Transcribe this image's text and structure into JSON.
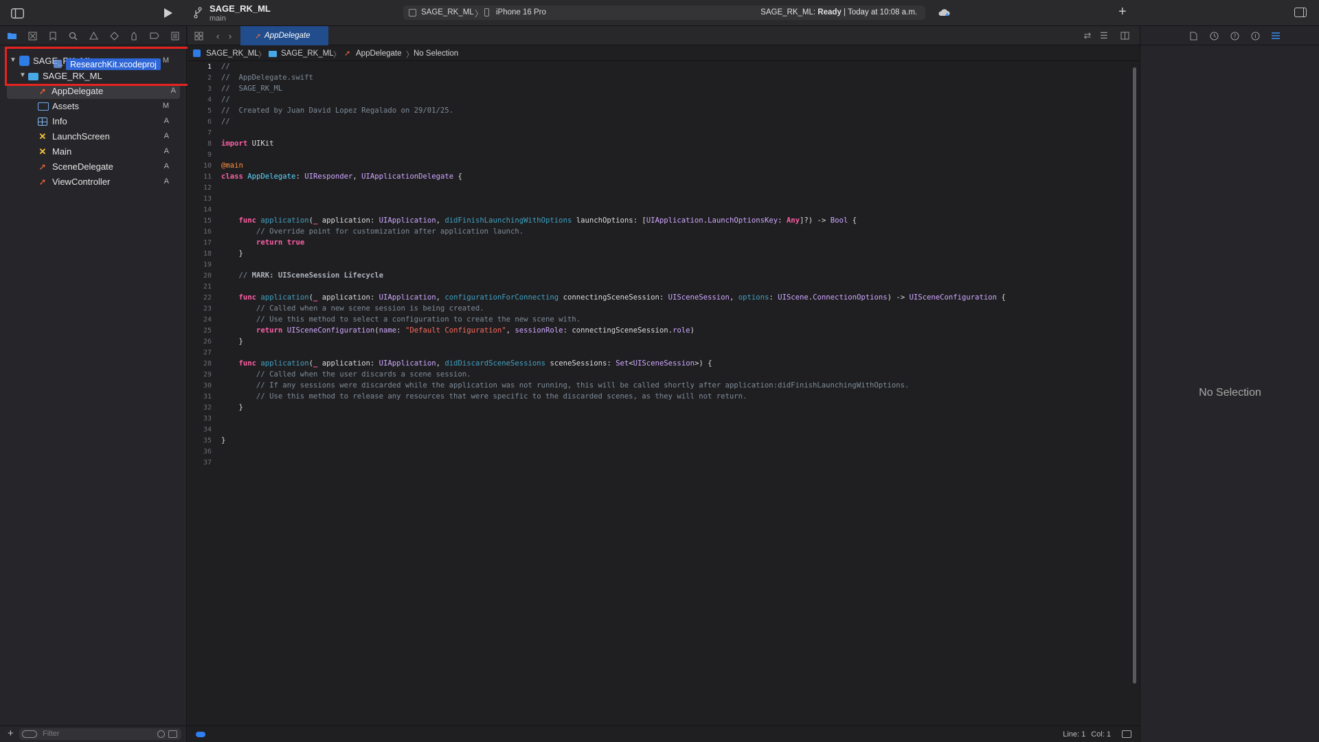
{
  "toolbar": {
    "project_title": "SAGE_RK_ML",
    "branch": "main",
    "scheme": "SAGE_RK_ML",
    "scheme_separator": "〉",
    "device": "iPhone 16 Pro",
    "status_project": "SAGE_RK_ML:",
    "status_state": "Ready",
    "status_time": "| Today at 10:08 a.m."
  },
  "navigator": {
    "tabs": [
      "folder-icon",
      "xmark-square-icon",
      "bookmark-icon",
      "search-icon",
      "warning-icon",
      "diamond-icon",
      "spray-icon",
      "tag-icon",
      "list-icon"
    ],
    "tree": [
      {
        "label": "SAGE_RK_ML",
        "flag": "M",
        "kind": "project",
        "depth": 0
      },
      {
        "label": "SAGE_RK_ML",
        "flag": "",
        "kind": "folder",
        "depth": 1
      },
      {
        "label": "AppDelegate",
        "flag": "A",
        "kind": "swift",
        "depth": 2,
        "selected": true
      },
      {
        "label": "Assets",
        "flag": "M",
        "kind": "assets",
        "depth": 2
      },
      {
        "label": "Info",
        "flag": "A",
        "kind": "plist",
        "depth": 2
      },
      {
        "label": "LaunchScreen",
        "flag": "A",
        "kind": "storyboard",
        "depth": 2
      },
      {
        "label": "Main",
        "flag": "A",
        "kind": "storyboard",
        "depth": 2
      },
      {
        "label": "SceneDelegate",
        "flag": "A",
        "kind": "swift",
        "depth": 2
      },
      {
        "label": "ViewController",
        "flag": "A",
        "kind": "swift",
        "depth": 2
      }
    ],
    "drag_item": "ResearchKit.xcodeproj",
    "filter_placeholder": "Filter"
  },
  "editor": {
    "active_tab": "AppDelegate",
    "jump_bar": [
      "SAGE_RK_ML",
      "SAGE_RK_ML",
      "AppDelegate",
      "No Selection"
    ],
    "jump_sep": "〉",
    "line_numbers": [
      "1",
      "2",
      "3",
      "4",
      "5",
      "6",
      "7",
      "8",
      "9",
      "10",
      "11",
      "12",
      "13",
      "14",
      "15",
      "16",
      "17",
      "18",
      "19",
      "20",
      "21",
      "22",
      "23",
      "24",
      "25",
      "26",
      "27",
      "28",
      "29",
      "30",
      "31",
      "32",
      "33",
      "34",
      "35",
      "36",
      "37"
    ],
    "status_line": "Line: 1",
    "status_col": "Col: 1"
  },
  "inspector": {
    "no_selection": "No Selection"
  },
  "colors": {
    "accent": "#2f67d8",
    "keyword": "#fc5fa3",
    "comment": "#7f8c98",
    "string": "#fc6a5d",
    "type": "#d0a8ff",
    "annotation_box": "#e8231f"
  }
}
